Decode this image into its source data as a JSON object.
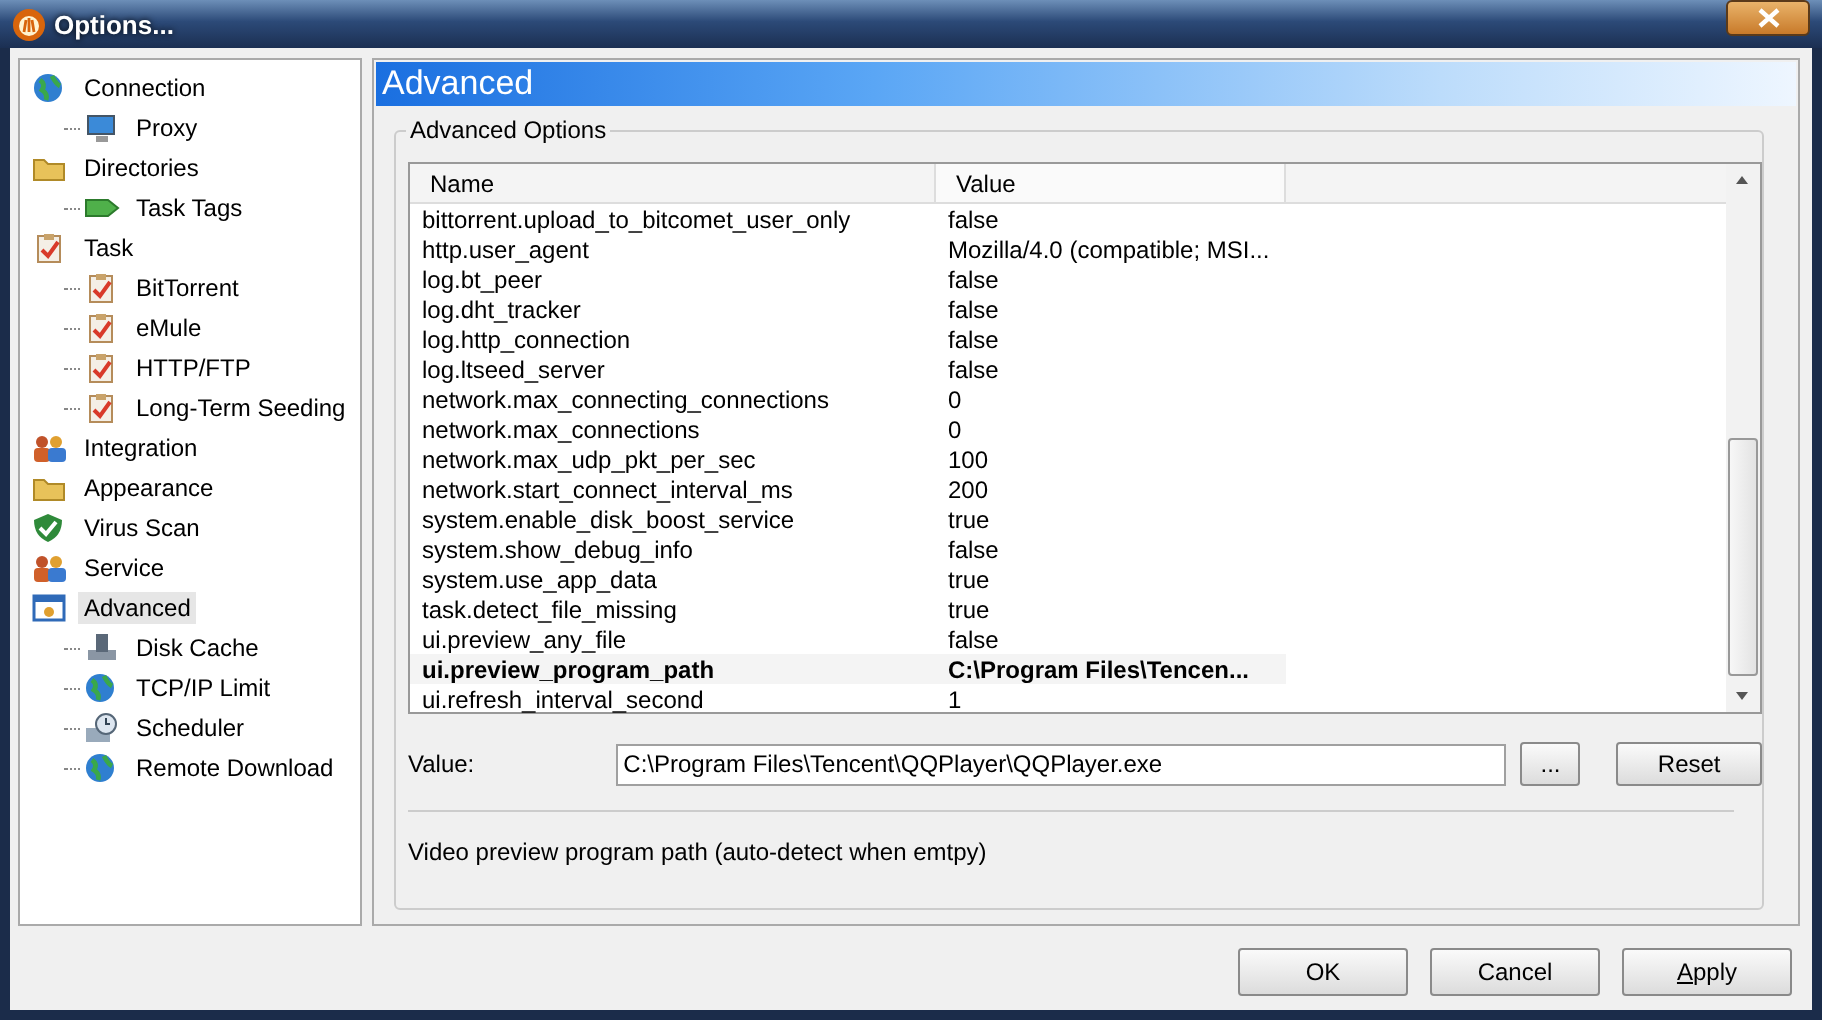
{
  "window": {
    "title": "Options..."
  },
  "sidebar": {
    "items": [
      {
        "label": "Connection",
        "kind": "globe",
        "selected": false,
        "children": [
          {
            "label": "Proxy",
            "kind": "monitor",
            "selected": false
          }
        ]
      },
      {
        "label": "Directories",
        "kind": "folder",
        "selected": false,
        "children": [
          {
            "label": "Task Tags",
            "kind": "tag",
            "selected": false
          }
        ]
      },
      {
        "label": "Task",
        "kind": "clipboard",
        "selected": false,
        "children": [
          {
            "label": "BitTorrent",
            "kind": "clipboard",
            "selected": false
          },
          {
            "label": "eMule",
            "kind": "clipboard",
            "selected": false
          },
          {
            "label": "HTTP/FTP",
            "kind": "clipboard",
            "selected": false
          },
          {
            "label": "Long-Term Seeding",
            "kind": "clipboard",
            "selected": false
          }
        ]
      },
      {
        "label": "Integration",
        "kind": "people",
        "selected": false
      },
      {
        "label": "Appearance",
        "kind": "folder",
        "selected": false
      },
      {
        "label": "Virus Scan",
        "kind": "shield",
        "selected": false
      },
      {
        "label": "Service",
        "kind": "people",
        "selected": false
      },
      {
        "label": "Advanced",
        "kind": "window",
        "selected": true,
        "children": [
          {
            "label": "Disk Cache",
            "kind": "disk",
            "selected": false
          },
          {
            "label": "TCP/IP Limit",
            "kind": "globe",
            "selected": false
          },
          {
            "label": "Scheduler",
            "kind": "clock",
            "selected": false
          },
          {
            "label": "Remote Download",
            "kind": "globe",
            "selected": false
          }
        ]
      }
    ]
  },
  "panel": {
    "title": "Advanced",
    "group_title": "Advanced Options",
    "table": {
      "columns": [
        "Name",
        "Value"
      ],
      "rows": [
        {
          "name": "bittorrent.upload_to_bitcomet_user_only",
          "value": "false",
          "selected": false
        },
        {
          "name": "http.user_agent",
          "value": "Mozilla/4.0 (compatible; MSI...",
          "selected": false
        },
        {
          "name": "log.bt_peer",
          "value": "false",
          "selected": false
        },
        {
          "name": "log.dht_tracker",
          "value": "false",
          "selected": false
        },
        {
          "name": "log.http_connection",
          "value": "false",
          "selected": false
        },
        {
          "name": "log.ltseed_server",
          "value": "false",
          "selected": false
        },
        {
          "name": "network.max_connecting_connections",
          "value": "0",
          "selected": false
        },
        {
          "name": "network.max_connections",
          "value": "0",
          "selected": false
        },
        {
          "name": "network.max_udp_pkt_per_sec",
          "value": "100",
          "selected": false
        },
        {
          "name": "network.start_connect_interval_ms",
          "value": "200",
          "selected": false
        },
        {
          "name": "system.enable_disk_boost_service",
          "value": "true",
          "selected": false
        },
        {
          "name": "system.show_debug_info",
          "value": "false",
          "selected": false
        },
        {
          "name": "system.use_app_data",
          "value": "true",
          "selected": false
        },
        {
          "name": "task.detect_file_missing",
          "value": "true",
          "selected": false
        },
        {
          "name": "ui.preview_any_file",
          "value": "false",
          "selected": false
        },
        {
          "name": "ui.preview_program_path",
          "value": "C:\\Program Files\\Tencen...",
          "selected": true
        },
        {
          "name": "ui.refresh_interval_second",
          "value": "1",
          "selected": false
        }
      ]
    },
    "value_label": "Value:",
    "value": "C:\\Program Files\\Tencent\\QQPlayer\\QQPlayer.exe",
    "browse_button": "...",
    "reset_button": "Reset",
    "description": "Video preview program path (auto-detect when emtpy)"
  },
  "buttons": [
    "OK",
    "Cancel",
    "Apply"
  ]
}
